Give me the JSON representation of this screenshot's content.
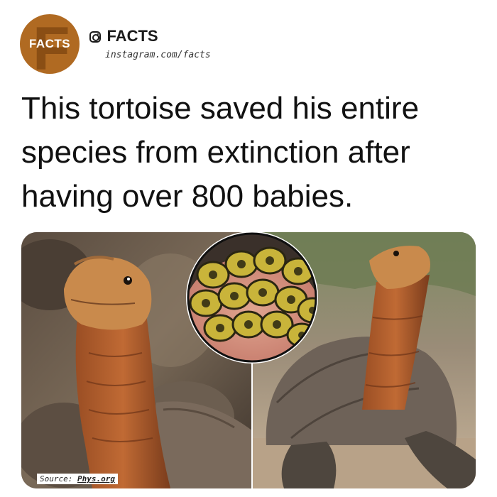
{
  "post": {
    "logo_text": "FACTS",
    "account_name": "FACTS",
    "account_url": "instagram.com/facts",
    "headline": "This tortoise saved his entire species from extinction after having over 800 babies.",
    "source_label": "Source:",
    "source_link": "Phys.org"
  },
  "colors": {
    "brand": "#b06a22",
    "text": "#111111"
  },
  "icons": {
    "account": "instagram-icon"
  }
}
